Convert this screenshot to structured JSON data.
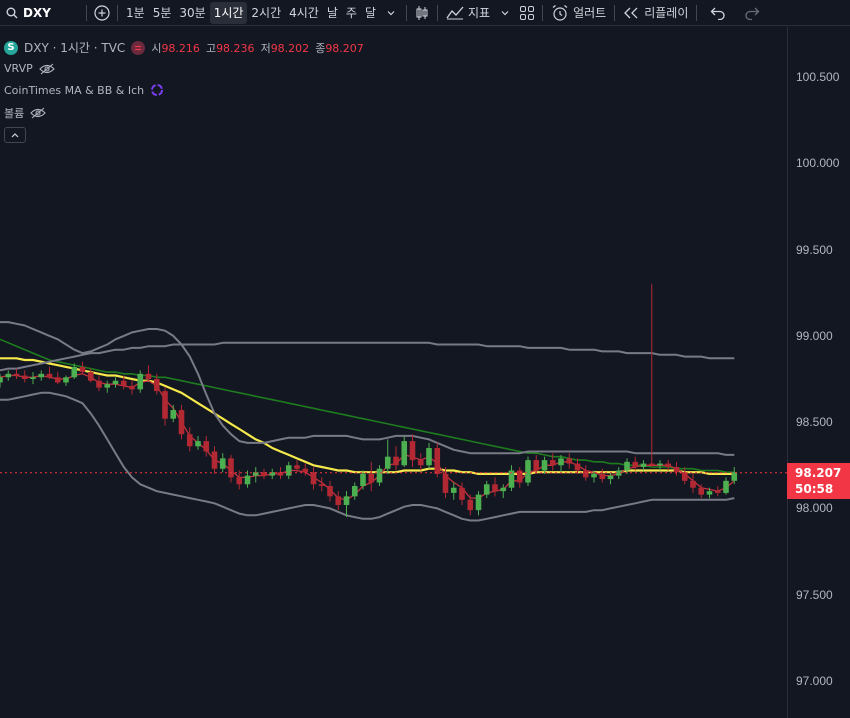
{
  "toolbar": {
    "symbol": "DXY",
    "intervals": [
      "1분",
      "5분",
      "30분",
      "1시간",
      "2시간",
      "4시간",
      "날",
      "주",
      "달"
    ],
    "active_interval": "1시간",
    "indicators_label": "지표",
    "alert_label": "얼러트",
    "replay_label": "리플레이",
    "icons": [
      "search-icon",
      "add-symbol-icon",
      "chevron-down-icon",
      "candles-icon",
      "indicators-icon",
      "layout-icon",
      "alarm-icon",
      "replay-icon",
      "undo-icon",
      "redo-icon"
    ]
  },
  "legend": {
    "symbol_badge": "S",
    "title": "DXY · 1시간 · TVC",
    "open_label": "시",
    "open": "98.216",
    "high_label": "고",
    "high": "98.236",
    "low_label": "저",
    "low": "98.202",
    "close_label": "종",
    "close": "98.207",
    "vrvp": "VRVP",
    "cointimes": "CoinTimes MA & BB & Ich",
    "volume": "볼륨"
  },
  "price_axis": {
    "ticks": [
      "100.500",
      "100.000",
      "99.500",
      "99.000",
      "98.500",
      "98.000",
      "97.500",
      "97.000"
    ],
    "current_price": "98.207",
    "countdown": "50:58"
  },
  "colors": {
    "background": "#131722",
    "up": "#26a69a",
    "up_candle": "#4caf50",
    "down_candle": "#b22833",
    "price_tag": "#f23645",
    "ma_yellow": "#f5e94b",
    "ma_green": "#1e7d1e",
    "ma_red": "#c2343e",
    "bb": "#787b86"
  },
  "chart_data": {
    "type": "candlestick",
    "symbol": "DXY",
    "interval": "1시간",
    "ylim": [
      96.9,
      100.8
    ],
    "candles": [
      [
        98.73,
        98.78,
        98.7,
        98.76
      ],
      [
        98.76,
        98.8,
        98.74,
        98.78
      ],
      [
        98.78,
        98.81,
        98.75,
        98.77
      ],
      [
        98.77,
        98.8,
        98.73,
        98.75
      ],
      [
        98.75,
        98.79,
        98.72,
        98.76
      ],
      [
        98.76,
        98.8,
        98.74,
        98.78
      ],
      [
        98.78,
        98.82,
        98.75,
        98.76
      ],
      [
        98.76,
        98.79,
        98.72,
        98.73
      ],
      [
        98.73,
        98.77,
        98.71,
        98.76
      ],
      [
        98.76,
        98.84,
        98.75,
        98.82
      ],
      [
        98.82,
        98.85,
        98.78,
        98.79
      ],
      [
        98.79,
        98.81,
        98.73,
        98.74
      ],
      [
        98.74,
        98.77,
        98.68,
        98.7
      ],
      [
        98.7,
        98.74,
        98.67,
        98.72
      ],
      [
        98.72,
        98.76,
        98.7,
        98.74
      ],
      [
        98.74,
        98.77,
        98.69,
        98.71
      ],
      [
        98.71,
        98.74,
        98.66,
        98.69
      ],
      [
        98.69,
        98.8,
        98.67,
        98.78
      ],
      [
        98.78,
        98.83,
        98.74,
        98.75
      ],
      [
        98.75,
        98.78,
        98.66,
        98.68
      ],
      [
        98.68,
        98.7,
        98.48,
        98.52
      ],
      [
        98.52,
        98.6,
        98.5,
        98.57
      ],
      [
        98.57,
        98.6,
        98.4,
        98.43
      ],
      [
        98.43,
        98.47,
        98.33,
        98.36
      ],
      [
        98.36,
        98.42,
        98.34,
        98.39
      ],
      [
        98.39,
        98.42,
        98.3,
        98.33
      ],
      [
        98.33,
        98.36,
        98.2,
        98.23
      ],
      [
        98.23,
        98.32,
        98.21,
        98.29
      ],
      [
        98.29,
        98.31,
        98.15,
        98.18
      ],
      [
        98.18,
        98.22,
        98.11,
        98.14
      ],
      [
        98.14,
        98.22,
        98.12,
        98.19
      ],
      [
        98.19,
        98.24,
        98.15,
        98.21
      ],
      [
        98.21,
        98.23,
        98.17,
        98.19
      ],
      [
        98.19,
        98.23,
        98.17,
        98.21
      ],
      [
        98.21,
        98.24,
        98.17,
        98.19
      ],
      [
        98.19,
        98.27,
        98.17,
        98.25
      ],
      [
        98.25,
        98.28,
        98.21,
        98.23
      ],
      [
        98.23,
        98.26,
        98.19,
        98.21
      ],
      [
        98.21,
        98.24,
        98.11,
        98.14
      ],
      [
        98.14,
        98.18,
        98.1,
        98.13
      ],
      [
        98.13,
        98.16,
        98.04,
        98.07
      ],
      [
        98.07,
        98.1,
        97.99,
        98.02
      ],
      [
        98.02,
        98.1,
        97.95,
        98.07
      ],
      [
        98.07,
        98.15,
        98.05,
        98.13
      ],
      [
        98.13,
        98.22,
        98.11,
        98.2
      ],
      [
        98.2,
        98.27,
        98.1,
        98.15
      ],
      [
        98.15,
        98.25,
        98.13,
        98.23
      ],
      [
        98.23,
        98.4,
        98.2,
        98.3
      ],
      [
        98.3,
        98.36,
        98.22,
        98.25
      ],
      [
        98.25,
        98.42,
        98.24,
        98.39
      ],
      [
        98.39,
        98.43,
        98.24,
        98.28
      ],
      [
        98.28,
        98.32,
        98.22,
        98.25
      ],
      [
        98.25,
        98.38,
        98.23,
        98.35
      ],
      [
        98.35,
        98.38,
        98.18,
        98.2
      ],
      [
        98.2,
        98.24,
        98.06,
        98.09
      ],
      [
        98.09,
        98.15,
        98.05,
        98.12
      ],
      [
        98.12,
        98.15,
        98.02,
        98.05
      ],
      [
        98.05,
        98.08,
        97.96,
        97.99
      ],
      [
        97.99,
        98.1,
        97.96,
        98.08
      ],
      [
        98.08,
        98.16,
        98.06,
        98.14
      ],
      [
        98.14,
        98.18,
        98.07,
        98.1
      ],
      [
        98.1,
        98.14,
        98.06,
        98.12
      ],
      [
        98.12,
        98.25,
        98.1,
        98.22
      ],
      [
        98.22,
        98.24,
        98.12,
        98.15
      ],
      [
        98.15,
        98.3,
        98.13,
        98.28
      ],
      [
        98.28,
        98.31,
        98.2,
        98.22
      ],
      [
        98.22,
        98.3,
        98.2,
        98.28
      ],
      [
        98.28,
        98.32,
        98.22,
        98.25
      ],
      [
        98.25,
        98.31,
        98.21,
        98.29
      ],
      [
        98.29,
        98.32,
        98.23,
        98.26
      ],
      [
        98.26,
        98.29,
        98.2,
        98.22
      ],
      [
        98.22,
        98.25,
        98.16,
        98.18
      ],
      [
        98.18,
        98.22,
        98.15,
        98.2
      ],
      [
        98.2,
        98.23,
        98.15,
        98.17
      ],
      [
        98.17,
        98.21,
        98.14,
        98.19
      ],
      [
        98.19,
        98.24,
        98.17,
        98.22
      ],
      [
        98.22,
        98.29,
        98.2,
        98.27
      ],
      [
        98.27,
        98.3,
        98.22,
        98.24
      ],
      [
        98.24,
        98.28,
        98.22,
        98.26
      ],
      [
        98.26,
        99.3,
        98.24,
        98.25
      ],
      [
        98.25,
        98.28,
        98.22,
        98.26
      ],
      [
        98.26,
        98.28,
        98.22,
        98.24
      ],
      [
        98.24,
        98.27,
        98.19,
        98.21
      ],
      [
        98.21,
        98.24,
        98.14,
        98.16
      ],
      [
        98.16,
        98.2,
        98.09,
        98.12
      ],
      [
        98.12,
        98.14,
        98.06,
        98.08
      ],
      [
        98.08,
        98.12,
        98.06,
        98.1
      ],
      [
        98.1,
        98.13,
        98.07,
        98.09
      ],
      [
        98.09,
        98.18,
        98.08,
        98.16
      ],
      [
        98.16,
        98.24,
        98.14,
        98.21
      ]
    ],
    "series": [
      {
        "name": "",
        "color": "#f5e94b",
        "values": [
          98.87,
          98.87,
          98.87,
          98.86,
          98.86,
          98.85,
          98.84,
          98.83,
          98.82,
          98.81,
          98.8,
          98.79,
          98.78,
          98.77,
          98.77,
          98.76,
          98.75,
          98.74,
          98.74,
          98.73,
          98.71,
          98.69,
          98.67,
          98.64,
          98.61,
          98.58,
          98.55,
          98.52,
          98.49,
          98.46,
          98.43,
          98.4,
          98.38,
          98.35,
          98.33,
          98.31,
          98.29,
          98.27,
          98.25,
          98.24,
          98.23,
          98.22,
          98.22,
          98.21,
          98.21,
          98.21,
          98.21,
          98.21,
          98.21,
          98.22,
          98.22,
          98.22,
          98.23,
          98.23,
          98.22,
          98.22,
          98.21,
          98.21,
          98.2,
          98.2,
          98.2,
          98.2,
          98.2,
          98.2,
          98.2,
          98.21,
          98.21,
          98.21,
          98.21,
          98.21,
          98.21,
          98.21,
          98.21,
          98.21,
          98.21,
          98.21,
          98.22,
          98.22,
          98.22,
          98.22,
          98.22,
          98.22,
          98.22,
          98.21,
          98.21,
          98.21,
          98.2,
          98.2,
          98.2,
          98.2
        ]
      },
      {
        "name": "",
        "color": "#1e7d1e",
        "values": [
          98.98,
          98.96,
          98.94,
          98.92,
          98.9,
          98.88,
          98.86,
          98.85,
          98.84,
          98.83,
          98.82,
          98.81,
          98.8,
          98.79,
          98.79,
          98.78,
          98.78,
          98.77,
          98.77,
          98.76,
          98.76,
          98.75,
          98.74,
          98.73,
          98.72,
          98.71,
          98.7,
          98.69,
          98.68,
          98.67,
          98.66,
          98.65,
          98.64,
          98.63,
          98.62,
          98.61,
          98.6,
          98.59,
          98.58,
          98.57,
          98.56,
          98.55,
          98.54,
          98.53,
          98.52,
          98.51,
          98.5,
          98.49,
          98.48,
          98.47,
          98.46,
          98.45,
          98.44,
          98.43,
          98.42,
          98.41,
          98.4,
          98.39,
          98.38,
          98.37,
          98.36,
          98.35,
          98.34,
          98.33,
          98.32,
          98.32,
          98.31,
          98.3,
          98.3,
          98.29,
          98.28,
          98.28,
          98.27,
          98.27,
          98.26,
          98.26,
          98.25,
          98.25,
          98.25,
          98.24,
          98.24,
          98.24,
          98.23,
          98.23,
          98.23,
          98.22,
          98.22,
          98.22,
          98.21,
          98.21
        ]
      },
      {
        "name": "",
        "color": "#c2343e",
        "values": [
          98.76,
          98.77,
          98.77,
          98.76,
          98.76,
          98.77,
          98.76,
          98.75,
          98.75,
          98.77,
          98.78,
          98.76,
          98.73,
          98.72,
          98.72,
          98.71,
          98.7,
          98.73,
          98.74,
          98.71,
          98.63,
          98.58,
          98.5,
          98.42,
          98.38,
          98.34,
          98.28,
          98.26,
          98.22,
          98.18,
          98.18,
          98.19,
          98.19,
          98.2,
          98.2,
          98.22,
          98.22,
          98.21,
          98.18,
          98.15,
          98.11,
          98.06,
          98.05,
          98.08,
          98.13,
          98.15,
          98.19,
          98.25,
          98.26,
          98.31,
          98.3,
          98.28,
          98.3,
          98.26,
          98.19,
          98.15,
          98.12,
          98.06,
          98.06,
          98.09,
          98.1,
          98.11,
          98.16,
          98.16,
          98.21,
          98.22,
          98.25,
          98.25,
          98.27,
          98.27,
          98.25,
          98.22,
          98.21,
          98.19,
          98.19,
          98.2,
          98.23,
          98.24,
          98.25,
          98.25,
          98.25,
          98.25,
          98.23,
          98.2,
          98.16,
          98.12,
          98.11,
          98.1,
          98.12,
          98.16
        ]
      },
      {
        "name": "",
        "color": "#787b86",
        "values": [
          99.08,
          99.08,
          99.07,
          99.06,
          99.04,
          99.02,
          99.0,
          98.98,
          98.95,
          98.92,
          98.9,
          98.91,
          98.93,
          98.95,
          98.98,
          99.0,
          99.02,
          99.03,
          99.04,
          99.04,
          99.03,
          99.0,
          98.95,
          98.88,
          98.78,
          98.66,
          98.55,
          98.48,
          98.43,
          98.39,
          98.38,
          98.38,
          98.38,
          98.39,
          98.4,
          98.41,
          98.41,
          98.41,
          98.42,
          98.42,
          98.42,
          98.42,
          98.42,
          98.41,
          98.4,
          98.4,
          98.4,
          98.41,
          98.42,
          98.42,
          98.42,
          98.41,
          98.4,
          98.38,
          98.36,
          98.34,
          98.33,
          98.32,
          98.32,
          98.32,
          98.32,
          98.32,
          98.32,
          98.32,
          98.33,
          98.33,
          98.33,
          98.33,
          98.33,
          98.33,
          98.33,
          98.33,
          98.33,
          98.33,
          98.33,
          98.33,
          98.33,
          98.32,
          98.32,
          98.32,
          98.32,
          98.32,
          98.32,
          98.32,
          98.32,
          98.32,
          98.32,
          98.32,
          98.31,
          98.31
        ]
      },
      {
        "name": "",
        "color": "#787b86",
        "values": [
          98.63,
          98.63,
          98.64,
          98.65,
          98.66,
          98.67,
          98.67,
          98.66,
          98.65,
          98.63,
          98.61,
          98.55,
          98.48,
          98.4,
          98.32,
          98.24,
          98.18,
          98.14,
          98.12,
          98.1,
          98.09,
          98.08,
          98.07,
          98.06,
          98.05,
          98.04,
          98.03,
          98.01,
          97.99,
          97.97,
          97.96,
          97.96,
          97.97,
          97.98,
          97.99,
          98.0,
          98.01,
          98.02,
          98.02,
          98.01,
          98.0,
          97.98,
          97.96,
          97.95,
          97.94,
          97.94,
          97.95,
          97.97,
          97.99,
          98.01,
          98.02,
          98.02,
          98.01,
          98.0,
          97.98,
          97.96,
          97.94,
          97.93,
          97.93,
          97.94,
          97.95,
          97.96,
          97.97,
          97.98,
          97.98,
          97.98,
          97.98,
          97.98,
          97.98,
          97.98,
          97.98,
          97.98,
          97.99,
          97.99,
          98.0,
          98.01,
          98.02,
          98.03,
          98.04,
          98.05,
          98.05,
          98.05,
          98.05,
          98.05,
          98.05,
          98.05,
          98.05,
          98.05,
          98.05,
          98.06
        ]
      },
      {
        "name": "",
        "color": "#787b86",
        "values": [
          98.8,
          98.81,
          98.81,
          98.82,
          98.83,
          98.84,
          98.85,
          98.86,
          98.87,
          98.88,
          98.89,
          98.9,
          98.9,
          98.91,
          98.92,
          98.92,
          98.93,
          98.93,
          98.94,
          98.94,
          98.94,
          98.95,
          98.95,
          98.95,
          98.95,
          98.95,
          98.95,
          98.96,
          98.96,
          98.96,
          98.96,
          98.96,
          98.96,
          98.96,
          98.96,
          98.96,
          98.96,
          98.96,
          98.96,
          98.96,
          98.96,
          98.96,
          98.96,
          98.96,
          98.96,
          98.96,
          98.96,
          98.96,
          98.96,
          98.96,
          98.96,
          98.96,
          98.96,
          98.95,
          98.95,
          98.95,
          98.95,
          98.95,
          98.95,
          98.94,
          98.94,
          98.94,
          98.94,
          98.94,
          98.93,
          98.93,
          98.93,
          98.93,
          98.93,
          98.92,
          98.92,
          98.92,
          98.92,
          98.91,
          98.91,
          98.91,
          98.9,
          98.9,
          98.9,
          98.9,
          98.89,
          98.89,
          98.89,
          98.88,
          98.88,
          98.88,
          98.87,
          98.87,
          98.87,
          98.87
        ]
      }
    ],
    "last_price": 98.207
  }
}
